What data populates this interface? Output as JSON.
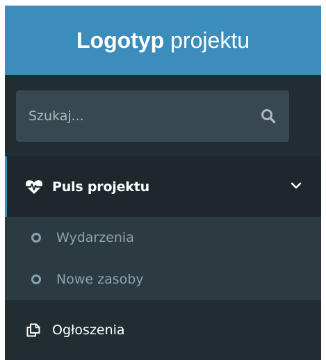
{
  "logo": {
    "bold": "Logotyp",
    "light": "projektu"
  },
  "search": {
    "placeholder": "Szukaj...",
    "icon": "search-icon"
  },
  "menu": {
    "pulse": {
      "label": "Puls projektu",
      "icon": "heartbeat-icon",
      "expanded": true,
      "children": [
        {
          "label": "Wydarzenia",
          "icon": "circle-outline-icon"
        },
        {
          "label": "Nowe zasoby",
          "icon": "circle-outline-icon"
        }
      ]
    },
    "announcements": {
      "label": "Ogłoszenia",
      "icon": "copy-icon"
    }
  },
  "colors": {
    "header": "#3c8dbc",
    "sidebar": "#222d32",
    "submenu": "#2c3b41",
    "active": "#1e282c",
    "search": "#374850"
  }
}
